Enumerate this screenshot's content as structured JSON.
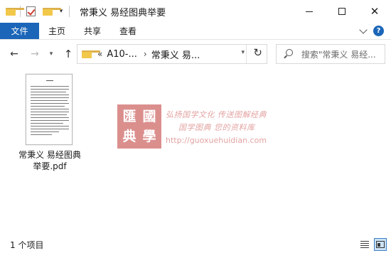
{
  "window": {
    "title": "常秉义 易经图典举要",
    "quick_access_dropdown": "▾",
    "controls": {
      "minimize": "",
      "maximize": "",
      "close": "✕"
    }
  },
  "ribbon": {
    "tabs": [
      {
        "label": "文件",
        "active": true
      },
      {
        "label": "主页"
      },
      {
        "label": "共享"
      },
      {
        "label": "查看"
      }
    ],
    "expand_icon": "chevron-down-icon",
    "help_label": "?"
  },
  "navigation": {
    "back": "←",
    "forward": "→",
    "recent": "▾",
    "up": "↑",
    "address": {
      "overflow": "«",
      "breadcrumbs": [
        "A10-...",
        "常秉义 易..."
      ],
      "separator": "›",
      "dropdown": "▾",
      "refresh": "↻"
    },
    "search": {
      "placeholder": "搜索\"常秉义 易经..."
    }
  },
  "content": {
    "files": [
      {
        "name_line1": "常秉义 易经图典",
        "name_line2": "举要.pdf",
        "type": "pdf",
        "thumbnail": "document-page"
      }
    ]
  },
  "watermark": {
    "seal_chars": [
      "匯",
      "國",
      "典",
      "學"
    ],
    "line1": "弘扬国学文化  传送图解经典",
    "line2": "国学图典  您的资料库",
    "url": "http://guoxuehuidian.com"
  },
  "statusbar": {
    "item_count": "1 个项目",
    "views": [
      {
        "name": "details",
        "active": false
      },
      {
        "name": "large-icons",
        "active": true
      }
    ]
  },
  "colors": {
    "accent": "#1b66b8",
    "folder": "#f2c84b",
    "watermark": "#cf6a68"
  }
}
